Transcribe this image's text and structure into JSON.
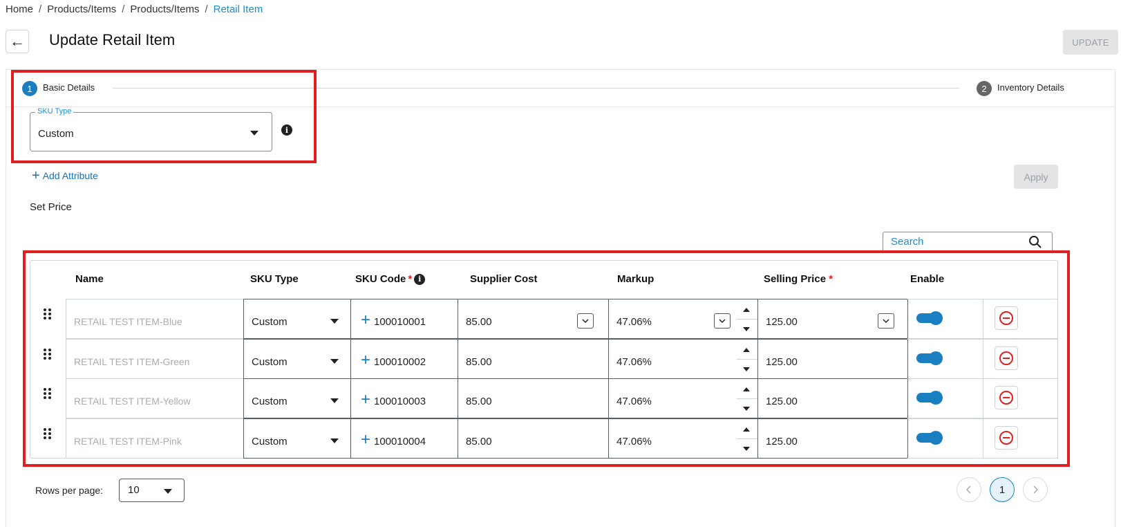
{
  "breadcrumb": [
    "Home",
    "Products/Items",
    "Products/Items",
    "Retail Item"
  ],
  "header": {
    "title": "Update Retail Item",
    "update_label": "UPDATE"
  },
  "stepper": {
    "steps": [
      {
        "number": "1",
        "label": "Basic Details"
      },
      {
        "number": "2",
        "label": "Inventory Details"
      }
    ]
  },
  "sku_type": {
    "label": "SKU Type",
    "value": "Custom"
  },
  "actions": {
    "add_attribute": "Add Attribute",
    "apply": "Apply"
  },
  "set_price": "Set Price",
  "search": {
    "placeholder": "Search"
  },
  "table": {
    "columns": [
      "Name",
      "SKU Type",
      "SKU Code",
      "Supplier Cost",
      "Markup",
      "Selling Price",
      "Enable"
    ],
    "required_mark": "*",
    "rows": [
      {
        "name": "RETAIL TEST ITEM-Blue",
        "sku_type": "Custom",
        "sku_code": "100010001",
        "supplier_cost": "85.00",
        "markup": "47.06%",
        "selling_price": "125.00",
        "enabled": true
      },
      {
        "name": "RETAIL TEST ITEM-Green",
        "sku_type": "Custom",
        "sku_code": "100010002",
        "supplier_cost": "85.00",
        "markup": "47.06%",
        "selling_price": "125.00",
        "enabled": true
      },
      {
        "name": "RETAIL TEST ITEM-Yellow",
        "sku_type": "Custom",
        "sku_code": "100010003",
        "supplier_cost": "85.00",
        "markup": "47.06%",
        "selling_price": "125.00",
        "enabled": true
      },
      {
        "name": "RETAIL TEST ITEM-Pink",
        "sku_type": "Custom",
        "sku_code": "100010004",
        "supplier_cost": "85.00",
        "markup": "47.06%",
        "selling_price": "125.00",
        "enabled": true
      }
    ]
  },
  "pagination": {
    "rows_per_page_label": "Rows per page:",
    "rows_per_page": "10",
    "current_page": "1"
  },
  "colors": {
    "accent": "#1a7fc0",
    "highlight_box": "#e02020",
    "required": "#e02020"
  }
}
